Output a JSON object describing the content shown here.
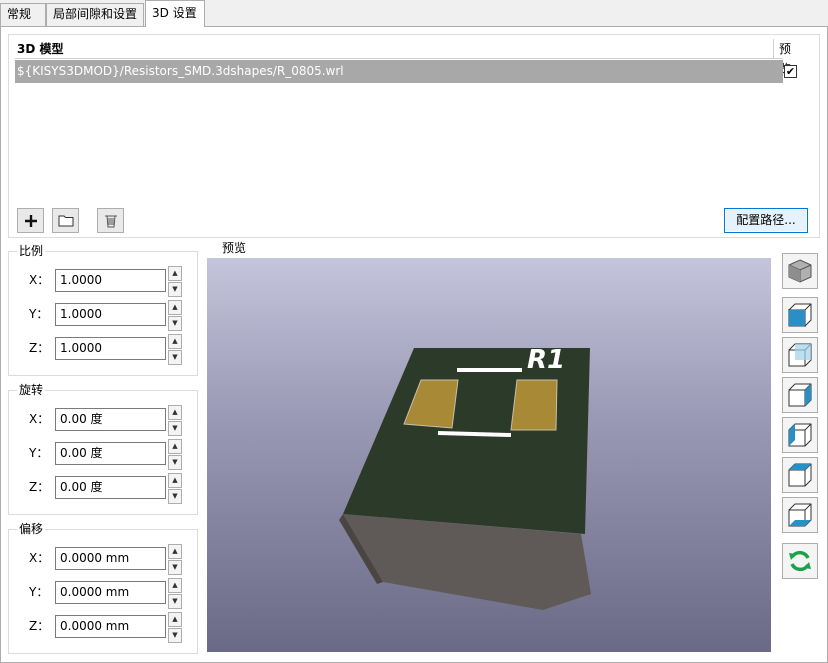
{
  "tabs": [
    {
      "label": "常规"
    },
    {
      "label": "局部间隙和设置"
    },
    {
      "label": "3D 设置"
    }
  ],
  "model_table": {
    "col_name": "3D 模型",
    "col_preview": "预览",
    "rows": [
      {
        "path": "${KISYS3DMOD}/Resistors_SMD.3dshapes/R_0805.wrl",
        "preview_checked": true,
        "check_glyph": "✔"
      }
    ]
  },
  "toolbar": {
    "add_icon": "plus-icon",
    "open_icon": "folder-icon",
    "delete_icon": "trash-icon",
    "configure_paths_label": "配置路径..."
  },
  "scale": {
    "title": "比例",
    "x_label": "X：",
    "x_value": "1.0000",
    "y_label": "Y：",
    "y_value": "1.0000",
    "z_label": "Z：",
    "z_value": "1.0000"
  },
  "rotation": {
    "title": "旋转",
    "x_label": "X：",
    "x_value": "0.00 度",
    "y_label": "Y：",
    "y_value": "0.00 度",
    "z_label": "Z：",
    "z_value": "0.00 度"
  },
  "offset": {
    "title": "偏移",
    "x_label": "X：",
    "x_value": "0.0000 mm",
    "y_label": "Y：",
    "y_value": "0.0000 mm",
    "z_label": "Z：",
    "z_value": "0.0000 mm"
  },
  "preview": {
    "label": "预览",
    "silkscreen_text": "R1"
  },
  "view_buttons": [
    {
      "icon": "view-3d-icon"
    },
    {
      "icon": "view-front-icon"
    },
    {
      "icon": "view-back-icon"
    },
    {
      "icon": "view-left-icon"
    },
    {
      "icon": "view-right-icon"
    },
    {
      "icon": "view-top-icon"
    },
    {
      "icon": "view-bottom-icon"
    },
    {
      "icon": "reload-icon"
    }
  ],
  "colors": {
    "selection": "#a8a8a8",
    "pcb_top": "#2b3a28",
    "pcb_side": "#5e5857",
    "pad": "#a88a36",
    "accent": "#0078d7"
  }
}
